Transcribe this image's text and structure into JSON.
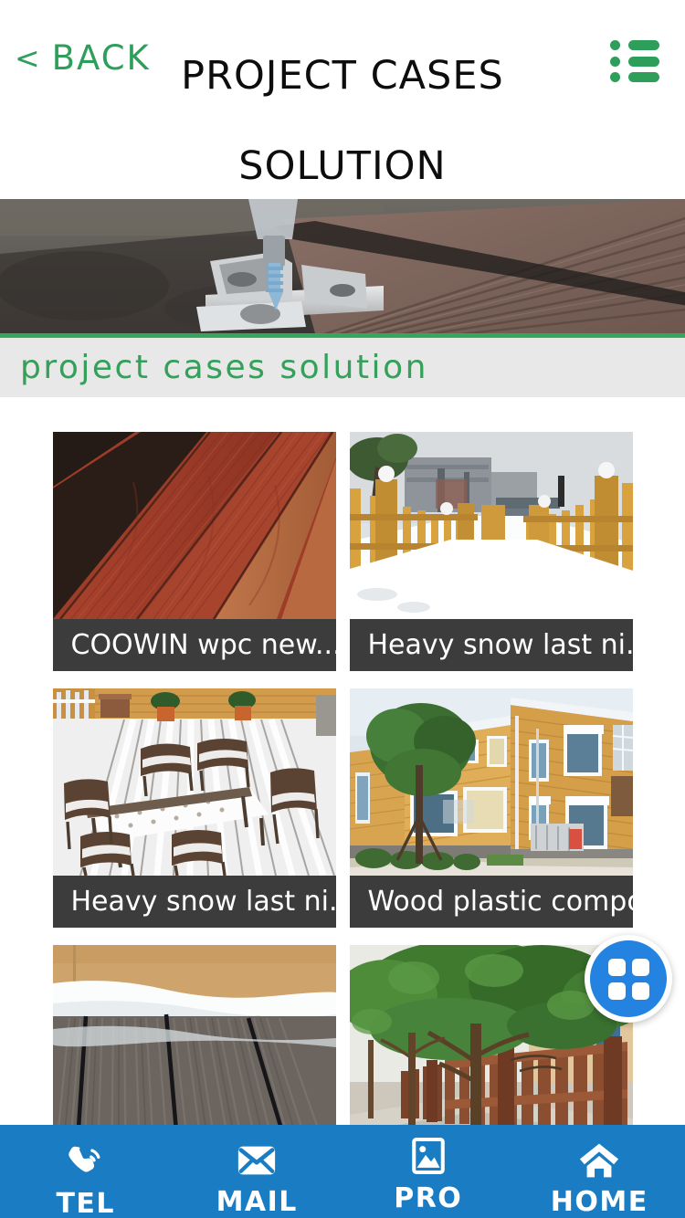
{
  "header": {
    "back_label": "BACK",
    "back_chevron": "<",
    "title_line1": "PROJECT CASES",
    "title_line2": "SOLUTION",
    "menu_icon": "list-menu-icon",
    "accent_green": "#2e9e5b",
    "title_color": "#0d0d0d"
  },
  "banner": {
    "alt": "wpc decking installation clip and screw",
    "divider_color": "#34a85a"
  },
  "section": {
    "title": "project cases solution",
    "background": "#e8e8e8",
    "text_color": "#34a05a"
  },
  "cards": [
    {
      "title": "COOWIN wpc new...",
      "thumb": "red-brown-wood-grain-decking-boards"
    },
    {
      "title": "Heavy snow last ni...",
      "thumb": "snowy-path-between-yellow-picket-fences"
    },
    {
      "title": "Heavy snow last ni...",
      "thumb": "snow-covered-patio-table-and-chairs"
    },
    {
      "title": "Wood plastic compo...",
      "thumb": "building-with-wpc-wall-cladding"
    },
    {
      "title": "",
      "thumb": "snow-on-grooved-grey-decking"
    },
    {
      "title": "",
      "thumb": "trees-along-brown-wpc-picket-fence"
    }
  ],
  "fab": {
    "icon": "grid-squares-icon",
    "color": "#2483e0"
  },
  "bottom_nav": {
    "background": "#1a7dc4",
    "items": [
      {
        "label": "TEL",
        "icon": "phone-icon"
      },
      {
        "label": "MAIL",
        "icon": "envelope-icon"
      },
      {
        "label": "PRO",
        "icon": "image-icon"
      },
      {
        "label": "HOME",
        "icon": "home-icon"
      }
    ]
  }
}
